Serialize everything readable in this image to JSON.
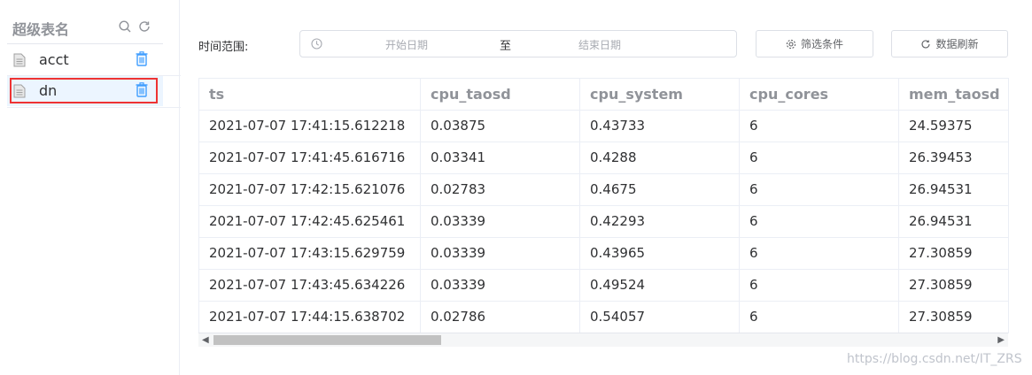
{
  "sidebar": {
    "title": "超级表名",
    "items": [
      {
        "label": "acct"
      },
      {
        "label": "dn"
      }
    ]
  },
  "filter": {
    "time_range_label": "时间范围:",
    "start_placeholder": "开始日期",
    "separator": "至",
    "end_placeholder": "结束日期",
    "filter_button": "筛选条件",
    "refresh_button": "数据刷新"
  },
  "table": {
    "columns": [
      "ts",
      "cpu_taosd",
      "cpu_system",
      "cpu_cores",
      "mem_taosd"
    ],
    "rows": [
      [
        "2021-07-07 17:41:15.612218",
        "0.03875",
        "0.43733",
        "6",
        "24.59375"
      ],
      [
        "2021-07-07 17:41:45.616716",
        "0.03341",
        "0.4288",
        "6",
        "26.39453"
      ],
      [
        "2021-07-07 17:42:15.621076",
        "0.02783",
        "0.4675",
        "6",
        "26.94531"
      ],
      [
        "2021-07-07 17:42:45.625461",
        "0.03339",
        "0.42293",
        "6",
        "26.94531"
      ],
      [
        "2021-07-07 17:43:15.629759",
        "0.03339",
        "0.43965",
        "6",
        "27.30859"
      ],
      [
        "2021-07-07 17:43:45.634226",
        "0.03339",
        "0.49524",
        "6",
        "27.30859"
      ],
      [
        "2021-07-07 17:44:15.638702",
        "0.02786",
        "0.54057",
        "6",
        "27.30859"
      ]
    ]
  },
  "watermark": "https://blog.csdn.net/IT_ZRS",
  "colors": {
    "accent": "#409eff",
    "highlight_border": "#e33333",
    "header_text": "#909399"
  }
}
